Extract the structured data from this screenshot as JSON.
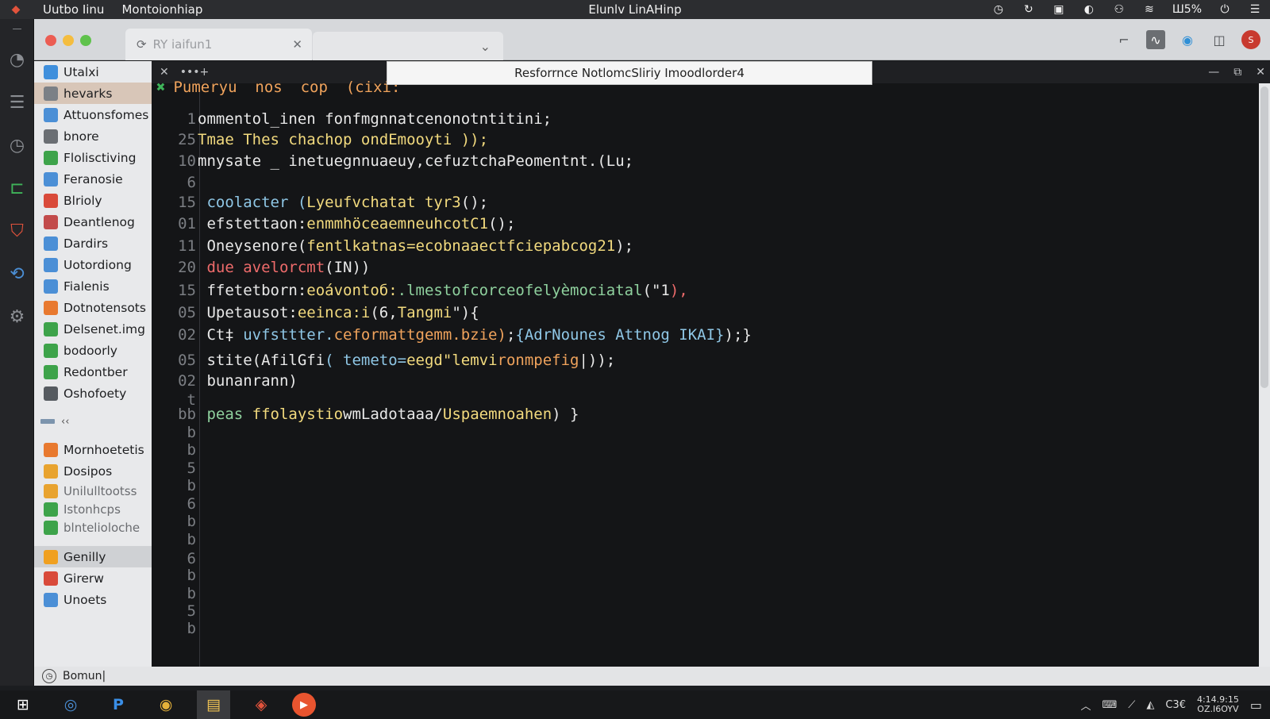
{
  "menubar": {
    "menu_1": "Uutbo Iinu",
    "menu_2": "Montoionhiap",
    "window_title": "Elunlv LinAHinp",
    "battery": "Ш5%"
  },
  "browser": {
    "tab_label": "RY iaifun1",
    "tab_close": "✕",
    "new_tab": "⌄"
  },
  "sidebar": {
    "items": [
      {
        "label": "Utalxi",
        "icon": "blue-square-icon",
        "color": "#3f8fdc"
      },
      {
        "label": "hevarks",
        "icon": "document-icon",
        "color": "#7b8086"
      },
      {
        "label": "Attuonsfomes",
        "icon": "folder-icon",
        "color": "#4b8fd6"
      },
      {
        "label": "bnore",
        "icon": "checkbox-icon",
        "color": "#6a6e73"
      },
      {
        "label": "Flolisctiving",
        "icon": "green-check-icon",
        "color": "#3da34a"
      },
      {
        "label": "Feranosie",
        "icon": "folder-icon",
        "color": "#4b8fd6"
      },
      {
        "label": "Blrioly",
        "icon": "red-gem-icon",
        "color": "#d94a3a"
      },
      {
        "label": "Deantlenog",
        "icon": "calendar-icon",
        "color": "#c24b4b"
      },
      {
        "label": "Dardirs",
        "icon": "folder-icon",
        "color": "#4b8fd6"
      },
      {
        "label": "Uotordiong",
        "icon": "folder-icon",
        "color": "#4b8fd6"
      },
      {
        "label": "Fialenis",
        "icon": "document-icon",
        "color": "#4b8fd6"
      },
      {
        "label": "Dotnotensots",
        "icon": "orange-square-icon",
        "color": "#e8792f"
      },
      {
        "label": "Delsenet.img",
        "icon": "green-check-icon",
        "color": "#3da34a"
      },
      {
        "label": "bodoorly",
        "icon": "green-square-icon",
        "color": "#3da34a"
      },
      {
        "label": "Redontber",
        "icon": "green-check-icon",
        "color": "#3da34a"
      },
      {
        "label": "Oshofoety",
        "icon": "gear-icon",
        "color": "#555a60"
      }
    ],
    "separator_text": "‹‹",
    "items_lower": [
      {
        "label": "Mornhoetetis",
        "icon": "orange-x-icon",
        "color": "#e8792f"
      },
      {
        "label": "Dosipos",
        "icon": "orange-check-icon",
        "color": "#e8a32f"
      }
    ],
    "items_muted": [
      {
        "label": "Unilulltootss",
        "icon": "orange-check-icon",
        "color": "#e8a32f"
      },
      {
        "label": "Istonhcps",
        "icon": "green-check-icon",
        "color": "#3da34a"
      },
      {
        "label": "blntelioloche",
        "icon": "green-square-icon",
        "color": "#3da34a"
      }
    ],
    "items_bottom": [
      {
        "label": "Genilly",
        "icon": "spark-icon",
        "color": "#f0a020"
      },
      {
        "label": "Girerw",
        "icon": "red-gem-icon",
        "color": "#d94a3a"
      },
      {
        "label": "Unoets",
        "icon": "folder-icon",
        "color": "#4b8fd6"
      }
    ]
  },
  "editor": {
    "bar_close": "✕",
    "bar_tab": "•••+",
    "popup_title": "Resforrnce NotlomcSliriy  Imoodlorder4",
    "first_line": "Pumeryu  nos  cop  (cixi:",
    "lines": [
      {
        "n": "1",
        "segs": [
          {
            "t": "ommentol_inen fonfmgnnatcenonotntitini;",
            "c": "c-white"
          }
        ]
      },
      {
        "n": "25",
        "segs": [
          {
            "t": "Tmae Thes ",
            "c": "c-yellow"
          },
          {
            "t": "chachop ondEmooyti ));",
            "c": "c-yellow"
          }
        ]
      },
      {
        "n": "10",
        "segs": [
          {
            "t": "mnysate _ inetuegnnuaeuy,cefuztchaPeomentnt.(Lu;",
            "c": "c-white"
          }
        ]
      },
      {
        "n": "6",
        "segs": []
      },
      {
        "n": "15",
        "segs": [
          {
            "t": " coolacter (",
            "c": "c-blue"
          },
          {
            "t": "Lyeufvchatat tyr3",
            "c": "c-yellow"
          },
          {
            "t": "();",
            "c": "c-white"
          }
        ]
      },
      {
        "n": "01",
        "segs": [
          {
            "t": " efstettaon:",
            "c": "c-white"
          },
          {
            "t": "enmmhöceaemneuhcotC1",
            "c": "c-yellow"
          },
          {
            "t": "();",
            "c": "c-white"
          }
        ]
      },
      {
        "n": "11",
        "segs": [
          {
            "t": " Oneysenore(",
            "c": "c-white"
          },
          {
            "t": "fentlkatnas=ecobnaaectfciepabcog21",
            "c": "c-yellow"
          },
          {
            "t": ");",
            "c": "c-white"
          }
        ]
      },
      {
        "n": "20",
        "segs": [
          {
            "t": " due avelorcmt",
            "c": "c-red"
          },
          {
            "t": "(IN))",
            "c": "c-white"
          }
        ]
      },
      {
        "n": "15",
        "segs": [
          {
            "t": " ffetetborn:",
            "c": "c-white"
          },
          {
            "t": "eoávontoб:",
            "c": "c-yellow"
          },
          {
            "t": ".lmestofcorceofelyèmociatal",
            "c": "c-green"
          },
          {
            "t": "(\"1",
            "c": "c-white"
          },
          {
            "t": "),",
            "c": "c-red"
          }
        ]
      },
      {
        "n": "05",
        "segs": [
          {
            "t": " Upetausot:",
            "c": "c-white"
          },
          {
            "t": "eeinca:i",
            "c": "c-yellow"
          },
          {
            "t": "(6,",
            "c": "c-white"
          },
          {
            "t": "Tangmi",
            "c": "c-yellow"
          },
          {
            "t": "\"){",
            "c": "c-white"
          }
        ]
      },
      {
        "n": "02",
        "segs": [
          {
            "t": " Ct‡ ",
            "c": "c-white"
          },
          {
            "t": "uvfsttter.",
            "c": "c-blue"
          },
          {
            "t": "ceformattgemm.bzie)",
            "c": "c-orange"
          },
          {
            "t": ";",
            "c": "c-white"
          },
          {
            "t": "{AdrNounes Attnog IKAI}",
            "c": "c-blue"
          },
          {
            "t": ");}",
            "c": "c-white"
          }
        ]
      },
      {
        "n": "05",
        "segs": [
          {
            "t": " stite(",
            "c": "c-white"
          },
          {
            "t": "AfilGfi",
            "c": "c-white"
          },
          {
            "t": "( temeto=",
            "c": "c-blue"
          },
          {
            "t": "eegd\"",
            "c": "c-yellow"
          },
          {
            "t": "lemvi",
            "c": "c-yellow"
          },
          {
            "t": "ronmpefig",
            "c": "c-orange"
          },
          {
            "t": "|));",
            "c": "c-white"
          }
        ]
      },
      {
        "n": "02",
        "segs": [
          {
            "t": " bunanrann)",
            "c": "c-white"
          }
        ]
      },
      {
        "n": "t",
        "segs": []
      },
      {
        "n": "bb",
        "segs": [
          {
            "t": " peas ",
            "c": "c-green"
          },
          {
            "t": "ffolaystio",
            "c": "c-yellow"
          },
          {
            "t": "wmLadotaaa/",
            "c": "c-white"
          },
          {
            "t": "Uspaemnoahen",
            "c": "c-yellow"
          },
          {
            "t": ") }",
            "c": "c-white"
          }
        ]
      },
      {
        "n": "b",
        "segs": []
      },
      {
        "n": "b",
        "segs": []
      },
      {
        "n": "5",
        "segs": []
      },
      {
        "n": "b",
        "segs": []
      },
      {
        "n": "6",
        "segs": []
      },
      {
        "n": "b",
        "segs": []
      },
      {
        "n": "b",
        "segs": []
      },
      {
        "n": "6",
        "segs": []
      },
      {
        "n": "b",
        "segs": []
      },
      {
        "n": "b",
        "segs": []
      },
      {
        "n": "5",
        "segs": []
      },
      {
        "n": "b",
        "segs": []
      }
    ]
  },
  "statusbar": {
    "label": "Bomun|"
  },
  "taskbar": {
    "clock_time": "4:14.9:15",
    "clock_date": "OZ.I6OYV",
    "tray_text": "C3€"
  }
}
